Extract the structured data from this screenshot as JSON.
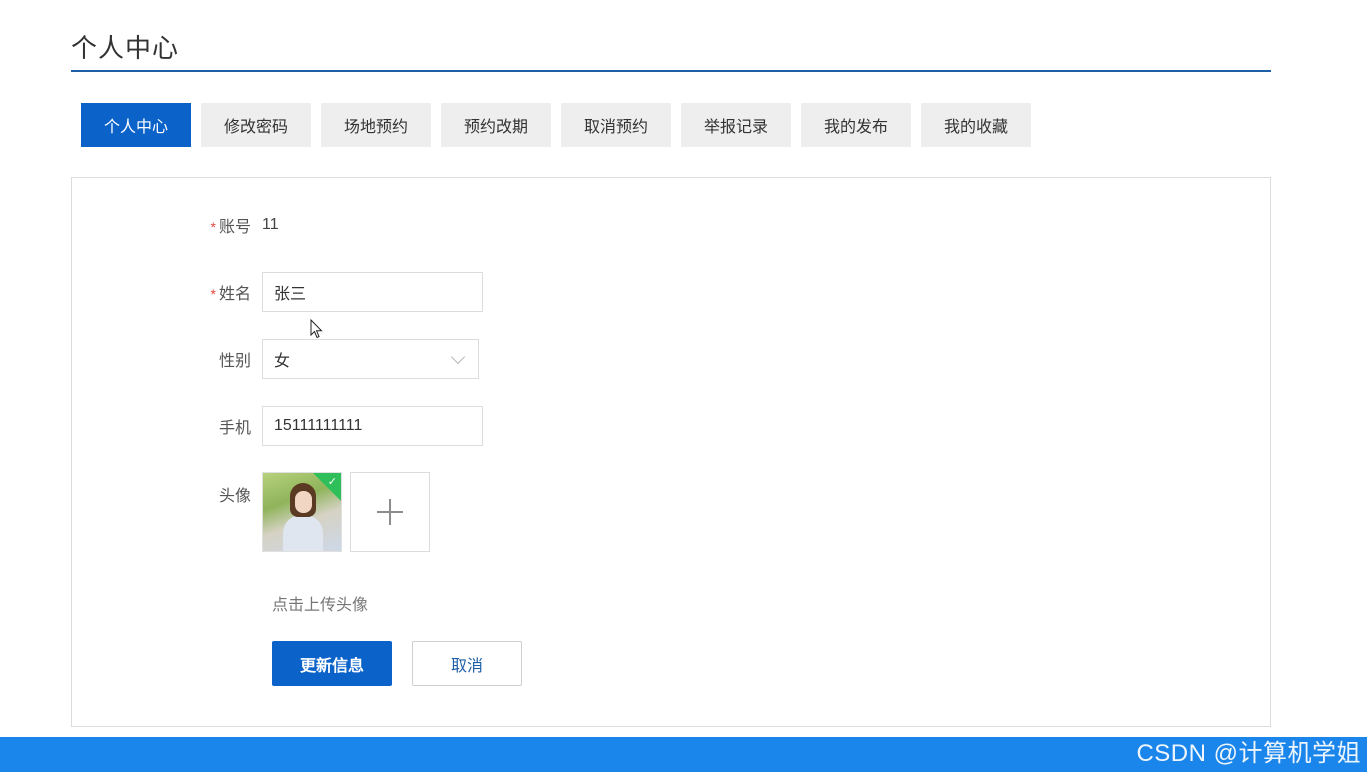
{
  "page": {
    "title": "个人中心"
  },
  "tabs": [
    {
      "label": "个人中心",
      "active": true
    },
    {
      "label": "修改密码",
      "active": false
    },
    {
      "label": "场地预约",
      "active": false
    },
    {
      "label": "预约改期",
      "active": false
    },
    {
      "label": "取消预约",
      "active": false
    },
    {
      "label": "举报记录",
      "active": false
    },
    {
      "label": "我的发布",
      "active": false
    },
    {
      "label": "我的收藏",
      "active": false
    }
  ],
  "form": {
    "required_mark": "*",
    "account": {
      "label": "账号",
      "value": "11"
    },
    "name": {
      "label": "姓名",
      "value": "张三"
    },
    "gender": {
      "label": "性别",
      "value": "女"
    },
    "phone": {
      "label": "手机",
      "value": "15111111111"
    },
    "avatar": {
      "label": "头像",
      "hint": "点击上传头像",
      "thumb_icon": "avatar-image",
      "add_icon": "plus-icon"
    }
  },
  "actions": {
    "submit_label": "更新信息",
    "cancel_label": "取消"
  },
  "watermark": "CSDN @计算机学姐",
  "colors": {
    "primary": "#0b63c9",
    "title_rule": "#1f5fa8",
    "footer": "#1a85ea",
    "required": "#e0483e",
    "success": "#2fbf5a"
  }
}
